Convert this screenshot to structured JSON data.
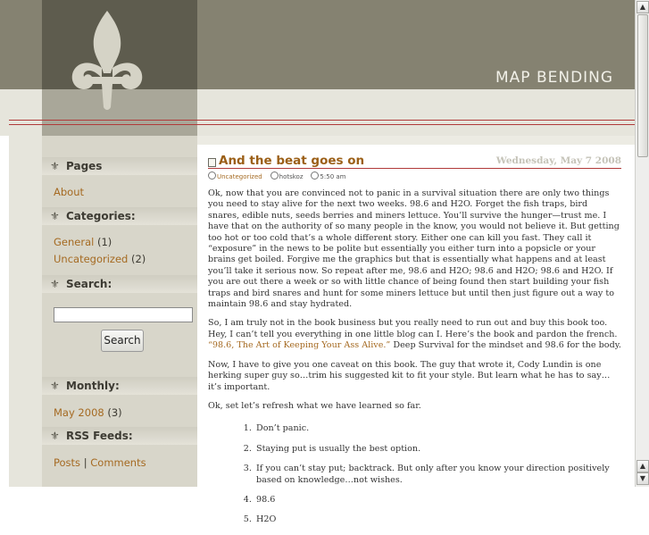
{
  "site": {
    "title": "MAP BENDING"
  },
  "sidebar": {
    "pages_heading": "Pages",
    "pages": [
      {
        "label": "About"
      }
    ],
    "categories_heading": "Categories:",
    "categories": [
      {
        "label": "General",
        "count": "(1)"
      },
      {
        "label": "Uncategorized",
        "count": "(2)"
      }
    ],
    "search_heading": "Search:",
    "search_button": "Search",
    "search_value": "",
    "monthly_heading": "Monthly:",
    "monthly": [
      {
        "label": "May 2008",
        "count": "(3)"
      }
    ],
    "rss_heading": "RSS Feeds:",
    "rss_posts": "Posts",
    "rss_separator": "|",
    "rss_comments": "Comments"
  },
  "post": {
    "title": "And the beat goes on",
    "date": "Wednesday, May 7 2008",
    "category": "Uncategorized",
    "author": "hotskoz",
    "time": "5:50 am",
    "p1": "Ok, now that you are convinced not to panic in a survival situation there are only two things you need to stay alive for the next two weeks.  98.6 and H2O. Forget the fish traps, bird snares, edible nuts, seeds berries and miners lettuce. You’ll survive the hunger—trust me. I have that on the authority of so many people in the know, you would not believe it. But getting too hot or too cold that’s a whole different story. Either one can kill you fast. They call it “exposure” in the news to be polite but essentially you either turn into a popsicle or your brains get boiled. Forgive me the graphics but that is essentially what happens and at least you’ll take it serious now. So repeat after me, 98.6 and H2O; 98.6 and H2O; 98.6 and H2O. If you are out there a week or so with little chance of being found then start building your fish traps and bird snares and hunt for some miners lettuce but until then just figure out a way to maintain 98.6 and stay hydrated.",
    "p2_before": "So, I am truly not in the book business but you really need to run out and buy this book too.  Hey, I can’t tell you everything in one little blog can I. Here’s the book and pardon the french. ",
    "p2_link": "“98.6, The Art of Keeping Your Ass Alive.”",
    "p2_after": "  Deep Survival for the mindset and 98.6 for the body.",
    "p3": "Now, I have to give you one caveat on this book.  The guy that wrote it, Cody Lundin is one herking super guy so…trim his suggested kit to fit your style. But learn what he has to say…it’s important.",
    "p4": "Ok, set let’s refresh what we have learned so far.",
    "list": [
      "Don’t panic.",
      "Staying put is usually the best option.",
      "If you can’t stay put; backtrack. But only after you know your direction positively based on knowledge…not wishes.",
      "98.6",
      "H2O"
    ]
  },
  "scrollbar": {
    "up": "▲",
    "down": "▼"
  }
}
